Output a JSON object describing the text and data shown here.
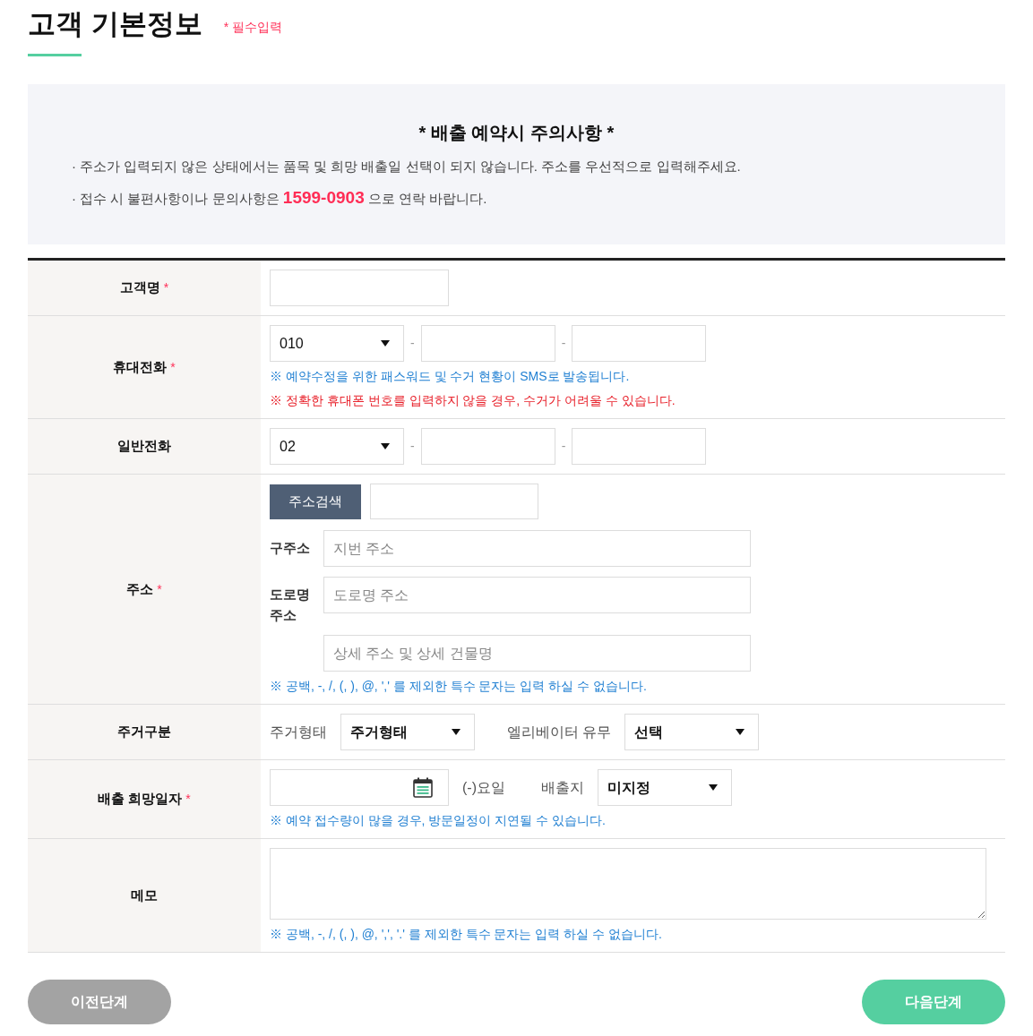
{
  "header": {
    "title": "고객 기본정보",
    "required_note": "* 필수입력"
  },
  "notice": {
    "title": "* 배출 예약시 주의사항 *",
    "items": [
      {
        "text": "· 주소가 입력되지 않은 상태에서는 품목 및 희망 배출일 선택이 되지 않습니다. 주소를 우선적으로 입력해주세요."
      },
      {
        "text": "· 접수 시 불편사항이나 문의사항은 ",
        "highlight": "1599-0903",
        "text_after": " 으로 연락 바랍니다."
      }
    ]
  },
  "rows": [
    {
      "kind": "name",
      "label": "고객명",
      "required_mark": "*"
    },
    {
      "kind": "phone",
      "label": "휴대전화",
      "required_mark": "*",
      "prefix": "010",
      "separators": [
        "-",
        "-"
      ],
      "notes": [
        {
          "kind": "info",
          "text": "※ 예약수정을 위한 패스워드 및 수거 현황이 SMS로 발송됩니다."
        },
        {
          "kind": "warning",
          "text": "※ 정확한 휴대폰 번호를 입력하지 않을 경우, 수거가 어려울 수 있습니다."
        }
      ]
    },
    {
      "kind": "phone",
      "label": "일반전화",
      "prefix": "02",
      "separators": [
        "-",
        "-"
      ]
    },
    {
      "kind": "address",
      "label": "주소",
      "required_mark": "*",
      "search_button": "주소검색",
      "fields": [
        {
          "label": "구주소",
          "placeholder": "지번 주소"
        },
        {
          "label": "도로명 주소",
          "placeholder": "도로명 주소"
        },
        {
          "placeholder": "상세 주소 및 상세 건물명"
        }
      ],
      "notes": [
        {
          "kind": "info",
          "text": "※ 공백, -, /, (, ), @, ',' 를 제외한 특수 문자는 입력 하실 수 없습니다."
        }
      ]
    },
    {
      "kind": "residence",
      "label": "주거구분",
      "selects": [
        {
          "label": "주거형태",
          "value": "주거형태"
        },
        {
          "label": "엘리베이터 유무",
          "value": "선택"
        }
      ]
    },
    {
      "kind": "date",
      "label": "배출 희망일자",
      "required_mark": "*",
      "weekday": "(-)요일",
      "place_label": "배출지",
      "place_value": "미지정",
      "notes": [
        {
          "kind": "info",
          "text": "※ 예약 접수량이 많을 경우, 방문일정이 지연될 수 있습니다."
        }
      ]
    },
    {
      "kind": "memo",
      "label": "메모",
      "notes": [
        {
          "kind": "info",
          "text": "※ 공백, -, /, (, ), @, ',', '.' 를 제외한 특수 문자는 입력 하실 수 없습니다."
        }
      ]
    }
  ],
  "buttons": [
    {
      "kind": "secondary",
      "label": "이전단계"
    },
    {
      "kind": "primary",
      "label": "다음단계"
    }
  ]
}
